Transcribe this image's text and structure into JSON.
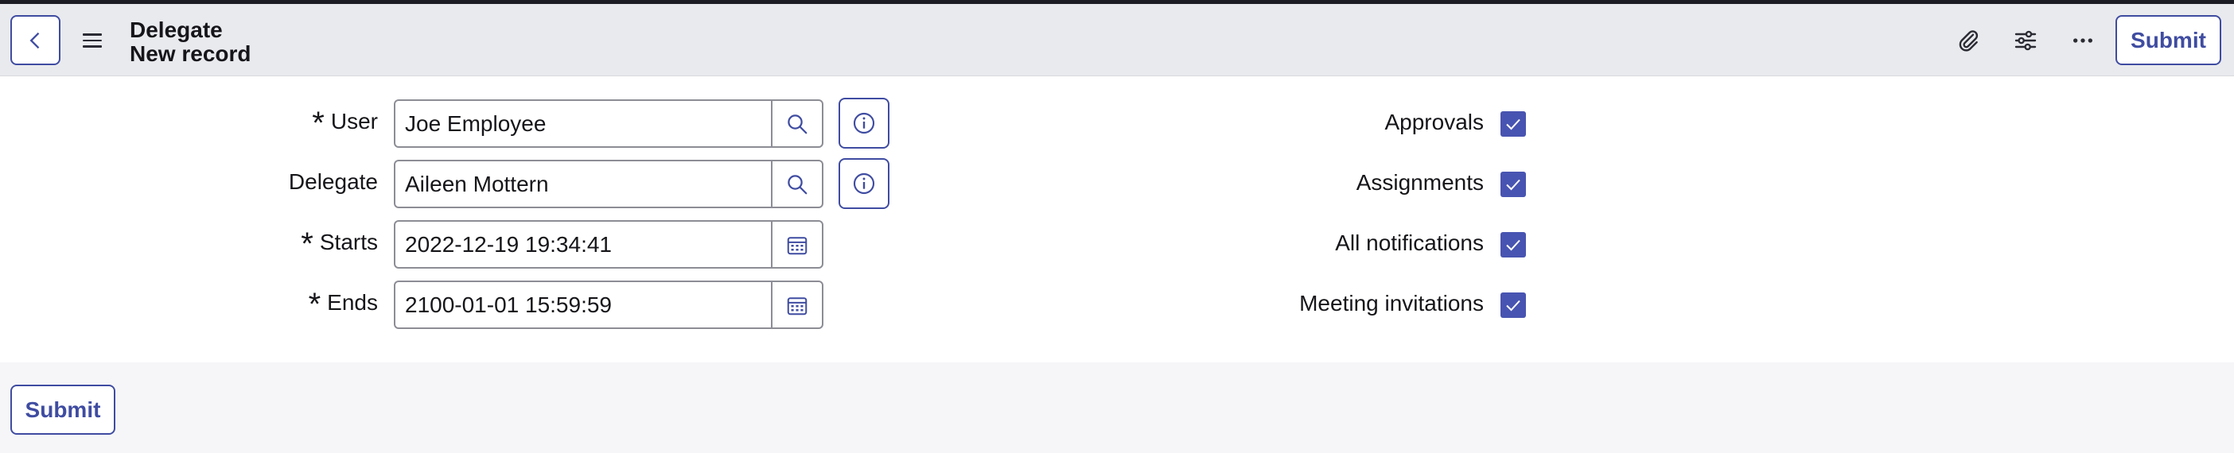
{
  "header": {
    "title_line1": "Delegate",
    "title_line2": "New record",
    "submit_label": "Submit"
  },
  "form": {
    "fields": [
      {
        "label": "User",
        "required": true,
        "value": "Joe Employee"
      },
      {
        "label": "Delegate",
        "required": false,
        "value": "Aileen Mottern"
      },
      {
        "label": "Starts",
        "required": true,
        "value": "2022-12-19 19:34:41"
      },
      {
        "label": "Ends",
        "required": true,
        "value": "2100-01-01 15:59:59"
      }
    ],
    "checkboxes": [
      {
        "label": "Approvals",
        "checked": true
      },
      {
        "label": "Assignments",
        "checked": true
      },
      {
        "label": "All notifications",
        "checked": true
      },
      {
        "label": "Meeting invitations",
        "checked": true
      }
    ]
  },
  "footer": {
    "submit_label": "Submit"
  },
  "colors": {
    "accent": "#3f4ca1",
    "checkbox": "#4854b1",
    "header_bg": "#e9eaee"
  }
}
